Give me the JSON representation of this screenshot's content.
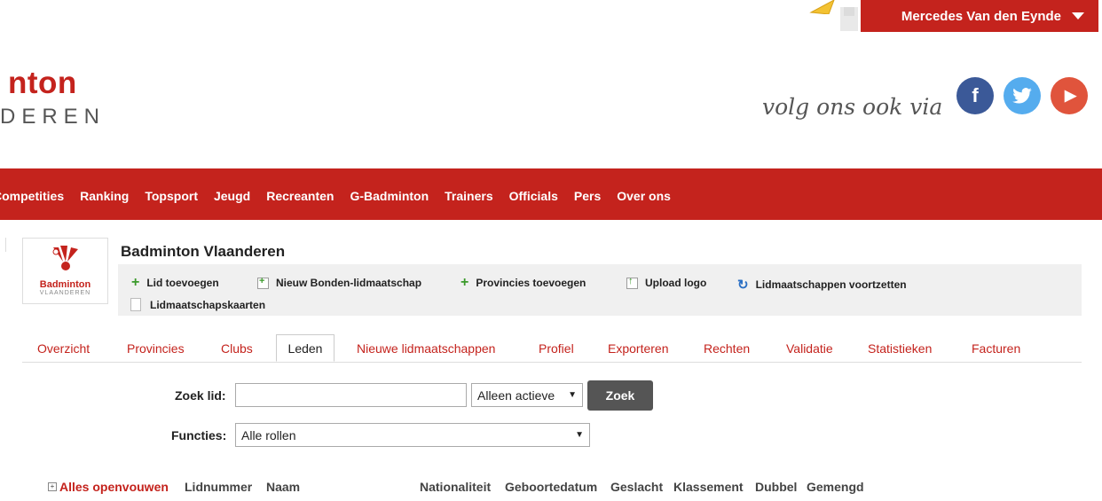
{
  "user": {
    "name": "Mercedes Van den Eynde"
  },
  "logo": {
    "top_text": "nton",
    "bottom_text": "DEREN"
  },
  "follow": {
    "text": "volg ons ook via"
  },
  "social": {
    "facebook": "f",
    "twitter": "t",
    "youtube": "▶"
  },
  "nav": {
    "items": [
      "Competities",
      "Ranking",
      "Topsport",
      "Jeugd",
      "Recreanten",
      "G-Badminton",
      "Trainers",
      "Officials",
      "Pers",
      "Over ons"
    ]
  },
  "org": {
    "title": "Badminton Vlaanderen",
    "logo_line1": "Badminton",
    "logo_line2": "VLAANDEREN"
  },
  "actions": {
    "add_member": "Lid toevoegen",
    "new_federation": "Nieuw Bonden-lidmaatschap",
    "add_provinces": "Provincies toevoegen",
    "upload_logo": "Upload logo",
    "continue_memberships": "Lidmaatschappen voortzetten",
    "membership_cards": "Lidmaatschapskaarten"
  },
  "tabs": [
    "Overzicht",
    "Provincies",
    "Clubs",
    "Leden",
    "Nieuwe lidmaatschappen",
    "Profiel",
    "Exporteren",
    "Rechten",
    "Validatie",
    "Statistieken",
    "Facturen"
  ],
  "active_tab": "Leden",
  "search": {
    "label": "Zoek lid:",
    "value": "",
    "status_selected": "Alleen actieve",
    "button": "Zoek",
    "roles_label": "Functies:",
    "roles_selected": "Alle rollen"
  },
  "table": {
    "expand_all": "Alles openvouwen",
    "columns": [
      "Lidnummer",
      "Naam",
      "Nationaliteit",
      "Geboortedatum",
      "Geslacht",
      "Klassement",
      "Dubbel",
      "Gemengd"
    ]
  },
  "colors": {
    "brand_red": "#c4231d",
    "facebook": "#3b5998",
    "twitter": "#55acee",
    "youtube": "#e0543c"
  }
}
